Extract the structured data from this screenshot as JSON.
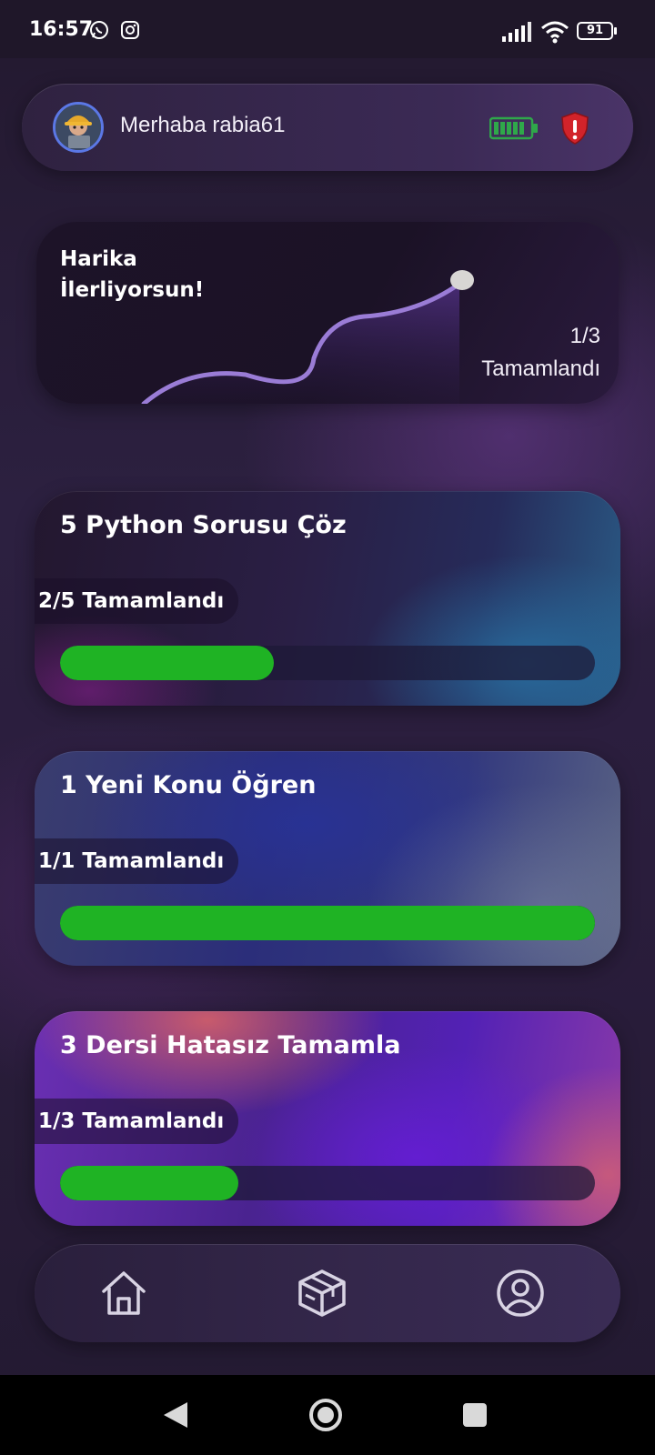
{
  "status_bar": {
    "time": "16:57",
    "battery": "91",
    "icons": [
      "whatsapp-icon",
      "instagram-icon",
      "signal-icon",
      "wifi-icon",
      "battery-icon"
    ]
  },
  "header": {
    "greeting": "Merhaba rabia61",
    "icons": [
      "avatar",
      "energy-battery-icon",
      "shield-alert-icon"
    ]
  },
  "summary": {
    "title": "Harika İlerliyorsun!",
    "count": "1/3",
    "status": "Tamamlandı",
    "progress": 0.333
  },
  "tasks": [
    {
      "title": "5 Python Sorusu Çöz",
      "progress_label": "2/5 Tamamlandı",
      "progress": 0.4
    },
    {
      "title": "1 Yeni Konu Öğren",
      "progress_label": "1/1 Tamamlandı",
      "progress": 1.0
    },
    {
      "title": "3 Dersi Hatasız Tamamla",
      "progress_label": "1/3 Tamamlandı",
      "progress": 0.333
    }
  ],
  "bottom_nav": {
    "items": [
      "home-icon",
      "box-icon",
      "profile-icon"
    ]
  },
  "colors": {
    "progress_fill": "#1fb324",
    "accent_avatar_ring": "#5b78e6",
    "energy_green": "#2fa84a",
    "shield_red": "#d2232a"
  }
}
